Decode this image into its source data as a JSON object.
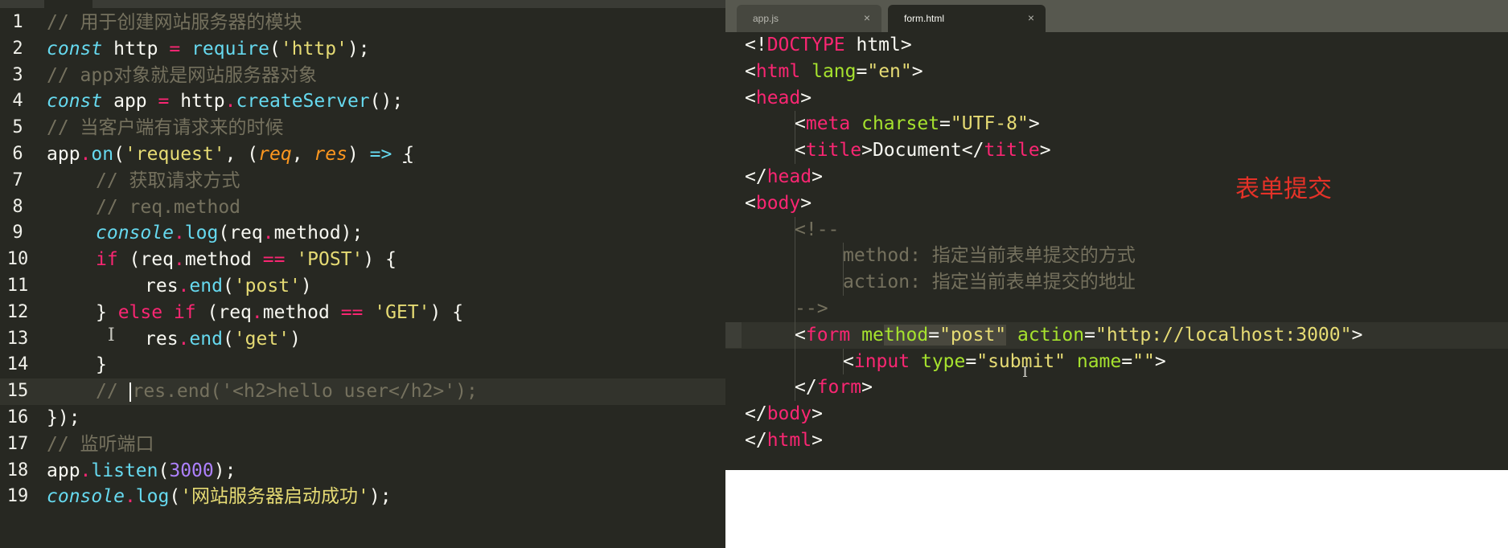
{
  "left_editor": {
    "lines": [
      {
        "num": "1",
        "parts": [
          {
            "cls": "c",
            "t": "// 用于创建网站服务器的模块"
          }
        ]
      },
      {
        "num": "2",
        "parts": [
          {
            "cls": "it",
            "t": "const"
          },
          {
            "cls": "",
            "t": " http "
          },
          {
            "cls": "k",
            "t": "="
          },
          {
            "cls": "",
            "t": " "
          },
          {
            "cls": "f",
            "t": "require"
          },
          {
            "cls": "",
            "t": "("
          },
          {
            "cls": "s",
            "t": "'http'"
          },
          {
            "cls": "",
            "t": ");"
          }
        ]
      },
      {
        "num": "3",
        "parts": [
          {
            "cls": "c",
            "t": "// app对象就是网站服务器对象"
          }
        ]
      },
      {
        "num": "4",
        "parts": [
          {
            "cls": "it",
            "t": "const"
          },
          {
            "cls": "",
            "t": " app "
          },
          {
            "cls": "k",
            "t": "="
          },
          {
            "cls": "",
            "t": " http"
          },
          {
            "cls": "k",
            "t": "."
          },
          {
            "cls": "f",
            "t": "createServer"
          },
          {
            "cls": "",
            "t": "();"
          }
        ]
      },
      {
        "num": "5",
        "parts": [
          {
            "cls": "c",
            "t": "// 当客户端有请求来的时候"
          }
        ]
      },
      {
        "num": "6",
        "parts": [
          {
            "cls": "",
            "t": "app"
          },
          {
            "cls": "k",
            "t": "."
          },
          {
            "cls": "f",
            "t": "on"
          },
          {
            "cls": "",
            "t": "("
          },
          {
            "cls": "s",
            "t": "'request'"
          },
          {
            "cls": "",
            "t": ", ("
          },
          {
            "cls": "p",
            "t": "req"
          },
          {
            "cls": "",
            "t": ", "
          },
          {
            "cls": "p",
            "t": "res"
          },
          {
            "cls": "",
            "t": ") "
          },
          {
            "cls": "f",
            "t": "=>"
          },
          {
            "cls": "",
            "t": " "
          },
          {
            "cls": "u",
            "t": "{"
          }
        ]
      },
      {
        "num": "7",
        "indent": 1,
        "parts": [
          {
            "cls": "c",
            "t": "// 获取请求方式"
          }
        ]
      },
      {
        "num": "8",
        "indent": 1,
        "parts": [
          {
            "cls": "c",
            "t": "// req.method"
          }
        ]
      },
      {
        "num": "9",
        "indent": 1,
        "parts": [
          {
            "cls": "it",
            "t": "console"
          },
          {
            "cls": "k",
            "t": "."
          },
          {
            "cls": "f",
            "t": "log"
          },
          {
            "cls": "",
            "t": "(req"
          },
          {
            "cls": "k",
            "t": "."
          },
          {
            "cls": "",
            "t": "method);"
          }
        ]
      },
      {
        "num": "10",
        "indent": 1,
        "parts": [
          {
            "cls": "k",
            "t": "if"
          },
          {
            "cls": "",
            "t": " (req"
          },
          {
            "cls": "k",
            "t": "."
          },
          {
            "cls": "",
            "t": "method "
          },
          {
            "cls": "k",
            "t": "=="
          },
          {
            "cls": "",
            "t": " "
          },
          {
            "cls": "s",
            "t": "'POST'"
          },
          {
            "cls": "",
            "t": ") {"
          }
        ]
      },
      {
        "num": "11",
        "indent": 2,
        "parts": [
          {
            "cls": "",
            "t": "res"
          },
          {
            "cls": "k",
            "t": "."
          },
          {
            "cls": "f",
            "t": "end"
          },
          {
            "cls": "",
            "t": "("
          },
          {
            "cls": "s",
            "t": "'post'"
          },
          {
            "cls": "",
            "t": ")"
          }
        ]
      },
      {
        "num": "12",
        "indent": 1,
        "parts": [
          {
            "cls": "",
            "t": "} "
          },
          {
            "cls": "k",
            "t": "else"
          },
          {
            "cls": "",
            "t": " "
          },
          {
            "cls": "k",
            "t": "if"
          },
          {
            "cls": "",
            "t": " (req"
          },
          {
            "cls": "k",
            "t": "."
          },
          {
            "cls": "",
            "t": "method "
          },
          {
            "cls": "k",
            "t": "=="
          },
          {
            "cls": "",
            "t": " "
          },
          {
            "cls": "s",
            "t": "'GET'"
          },
          {
            "cls": "",
            "t": ") {"
          }
        ]
      },
      {
        "num": "13",
        "indent": 2,
        "parts": [
          {
            "cls": "",
            "t": "res"
          },
          {
            "cls": "k",
            "t": "."
          },
          {
            "cls": "f",
            "t": "end"
          },
          {
            "cls": "",
            "t": "("
          },
          {
            "cls": "s",
            "t": "'get'"
          },
          {
            "cls": "",
            "t": ")"
          }
        ]
      },
      {
        "num": "14",
        "indent": 1,
        "parts": [
          {
            "cls": "",
            "t": "}"
          }
        ]
      },
      {
        "num": "15",
        "indent": 1,
        "active": true,
        "caret": true,
        "parts": [
          {
            "cls": "c",
            "t": "res.end('<h2>hello user</h2>');"
          }
        ],
        "prefix": "// "
      },
      {
        "num": "16",
        "parts": [
          {
            "cls": "",
            "t": "});"
          }
        ]
      },
      {
        "num": "17",
        "parts": [
          {
            "cls": "c",
            "t": "// 监听端口"
          }
        ]
      },
      {
        "num": "18",
        "parts": [
          {
            "cls": "",
            "t": "app"
          },
          {
            "cls": "k",
            "t": "."
          },
          {
            "cls": "f",
            "t": "listen"
          },
          {
            "cls": "",
            "t": "("
          },
          {
            "cls": "n",
            "t": "3000"
          },
          {
            "cls": "",
            "t": ");"
          }
        ]
      },
      {
        "num": "19",
        "parts": [
          {
            "cls": "it",
            "t": "console"
          },
          {
            "cls": "k",
            "t": "."
          },
          {
            "cls": "f",
            "t": "log"
          },
          {
            "cls": "",
            "t": "("
          },
          {
            "cls": "s",
            "t": "'网站服务器启动成功'"
          },
          {
            "cls": "",
            "t": ");"
          }
        ]
      }
    ]
  },
  "right_editor": {
    "tabs": [
      {
        "label": "app.js",
        "close": "×"
      },
      {
        "label": "form.html",
        "close": "×"
      }
    ],
    "lines": [
      {
        "indent": 0,
        "parts": [
          {
            "cls": "",
            "t": "<!"
          },
          {
            "cls": "t",
            "t": "DOCTYPE"
          },
          {
            "cls": "",
            "t": " html>"
          }
        ]
      },
      {
        "indent": 0,
        "parts": [
          {
            "cls": "",
            "t": "<"
          },
          {
            "cls": "t",
            "t": "html"
          },
          {
            "cls": "",
            "t": " "
          },
          {
            "cls": "a",
            "t": "lang"
          },
          {
            "cls": "",
            "t": "="
          },
          {
            "cls": "s",
            "t": "\"en\""
          },
          {
            "cls": "",
            "t": ">"
          }
        ]
      },
      {
        "indent": 0,
        "parts": [
          {
            "cls": "",
            "t": "<"
          },
          {
            "cls": "t",
            "t": "head"
          },
          {
            "cls": "",
            "t": ">"
          }
        ]
      },
      {
        "indent": 1,
        "parts": [
          {
            "cls": "",
            "t": "<"
          },
          {
            "cls": "t",
            "t": "meta"
          },
          {
            "cls": "",
            "t": " "
          },
          {
            "cls": "a",
            "t": "charset"
          },
          {
            "cls": "",
            "t": "="
          },
          {
            "cls": "s",
            "t": "\"UTF-8\""
          },
          {
            "cls": "",
            "t": ">"
          }
        ]
      },
      {
        "indent": 1,
        "parts": [
          {
            "cls": "",
            "t": "<"
          },
          {
            "cls": "t",
            "t": "title"
          },
          {
            "cls": "",
            "t": ">Document</"
          },
          {
            "cls": "t",
            "t": "title"
          },
          {
            "cls": "",
            "t": ">"
          }
        ]
      },
      {
        "indent": 0,
        "parts": [
          {
            "cls": "",
            "t": "</"
          },
          {
            "cls": "t",
            "t": "head"
          },
          {
            "cls": "",
            "t": ">"
          }
        ]
      },
      {
        "indent": 0,
        "parts": [
          {
            "cls": "",
            "t": "<"
          },
          {
            "cls": "t",
            "t": "body"
          },
          {
            "cls": "",
            "t": ">"
          }
        ]
      },
      {
        "indent": 1,
        "parts": [
          {
            "cls": "c",
            "t": "<!--"
          }
        ]
      },
      {
        "indent": 2,
        "parts": [
          {
            "cls": "c",
            "t": "method: 指定当前表单提交的方式"
          }
        ]
      },
      {
        "indent": 2,
        "parts": [
          {
            "cls": "c",
            "t": "action: 指定当前表单提交的地址"
          }
        ]
      },
      {
        "indent": 1,
        "parts": [
          {
            "cls": "c",
            "t": "-->"
          }
        ]
      },
      {
        "indent": 1,
        "active": true,
        "parts": [
          {
            "cls": "",
            "t": "<"
          },
          {
            "cls": "t",
            "t": "form"
          },
          {
            "cls": "",
            "t": " "
          },
          {
            "cls": "a",
            "t": "me"
          },
          {
            "cls": "a hl",
            "t": "thod"
          },
          {
            "cls": "hl",
            "t": "="
          },
          {
            "cls": "s hl",
            "t": "\"post\""
          },
          {
            "cls": "",
            "t": " "
          },
          {
            "cls": "a",
            "t": "action"
          },
          {
            "cls": "",
            "t": "="
          },
          {
            "cls": "s",
            "t": "\"http://localhost:3000\""
          },
          {
            "cls": "",
            "t": ">"
          }
        ]
      },
      {
        "indent": 2,
        "parts": [
          {
            "cls": "",
            "t": "<"
          },
          {
            "cls": "t",
            "t": "input"
          },
          {
            "cls": "",
            "t": " "
          },
          {
            "cls": "a",
            "t": "type"
          },
          {
            "cls": "",
            "t": "="
          },
          {
            "cls": "s",
            "t": "\"submit\""
          },
          {
            "cls": "",
            "t": " "
          },
          {
            "cls": "a",
            "t": "name"
          },
          {
            "cls": "",
            "t": "="
          },
          {
            "cls": "s",
            "t": "\"\""
          },
          {
            "cls": "",
            "t": ">"
          }
        ]
      },
      {
        "indent": 1,
        "parts": [
          {
            "cls": "",
            "t": "</"
          },
          {
            "cls": "t",
            "t": "form"
          },
          {
            "cls": "",
            "t": ">"
          }
        ]
      },
      {
        "indent": 0,
        "parts": [
          {
            "cls": "",
            "t": "</"
          },
          {
            "cls": "t",
            "t": "body"
          },
          {
            "cls": "",
            "t": ">"
          }
        ]
      },
      {
        "indent": 0,
        "parts": [
          {
            "cls": "",
            "t": "</"
          },
          {
            "cls": "t",
            "t": "html"
          },
          {
            "cls": "",
            "t": ">"
          }
        ]
      }
    ]
  },
  "annotation": {
    "text": "表单提交",
    "color": "#e53228"
  },
  "theme": {
    "editor_bg": "#272822",
    "keyword": "#f92672",
    "string": "#e6db74",
    "function": "#66d9ef",
    "comment": "#75715e",
    "attribute": "#a6e22e",
    "number": "#ae81ff"
  }
}
